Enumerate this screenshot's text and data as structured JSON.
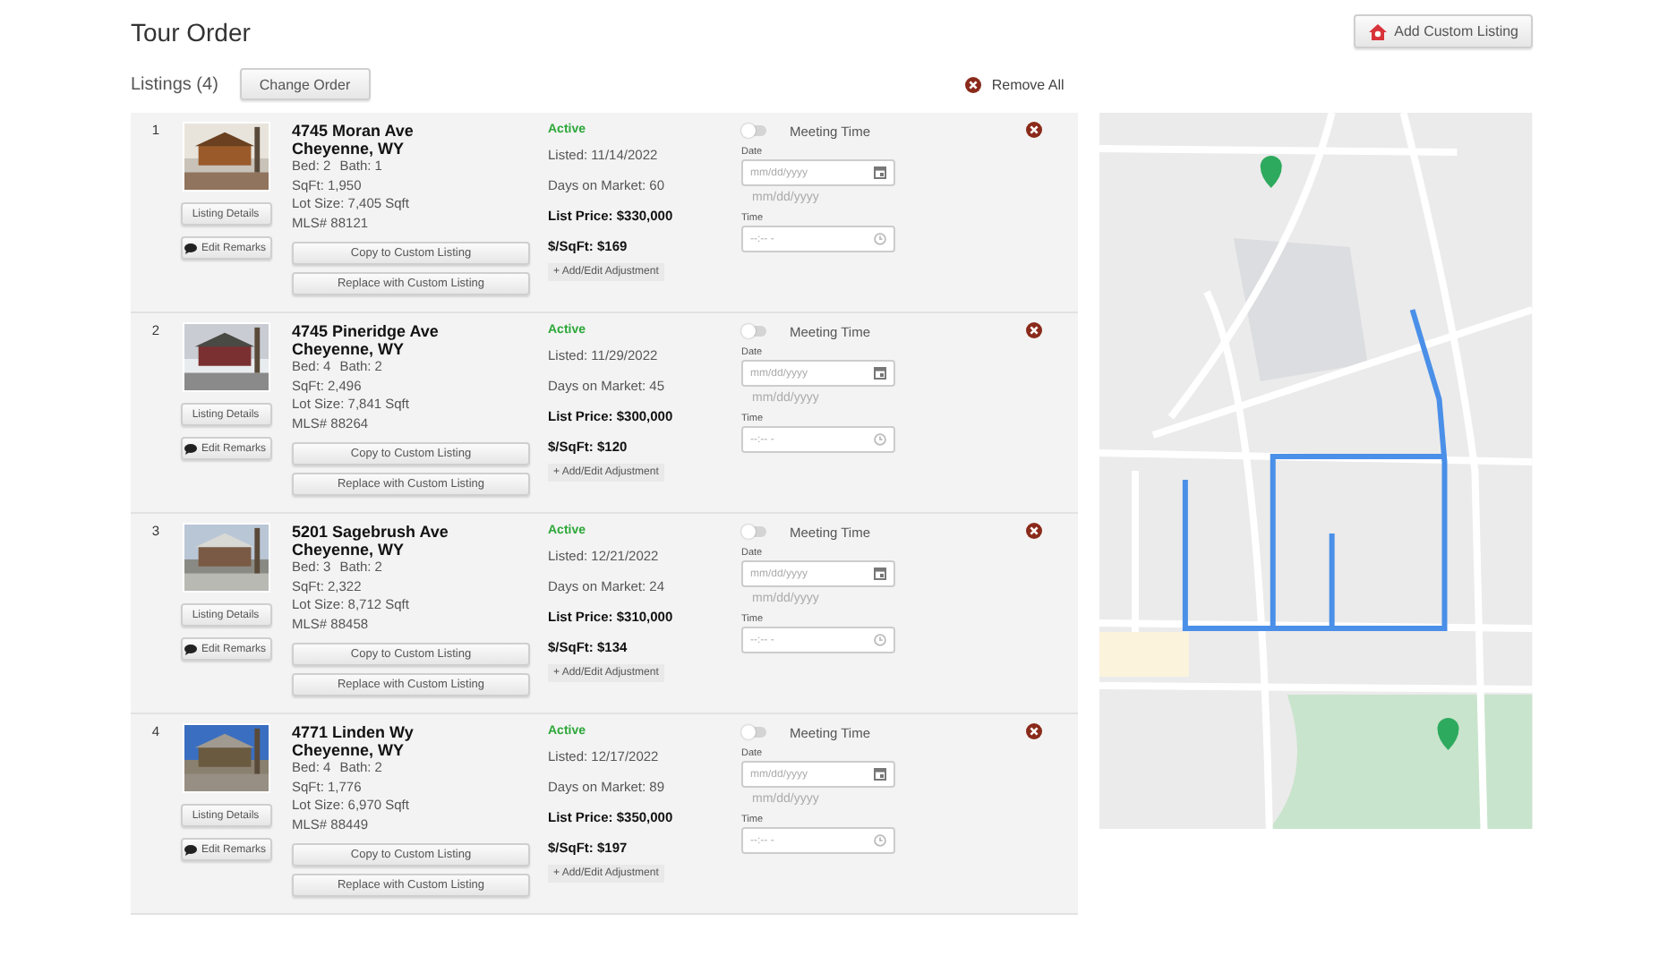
{
  "title": "Tour Order",
  "add_custom_listing": "Add Custom Listing",
  "listings_label": "Listings (4)",
  "change_order": "Change Order",
  "remove_all": "Remove All",
  "listings": [
    {
      "number": "1",
      "listing_details": "Listing Details",
      "edit_remarks": "Edit Remarks",
      "street": "4745 Moran Ave",
      "city": "Cheyenne, WY",
      "bed": "Bed: 2",
      "bath": "Bath: 1",
      "sqft": "SqFt: 1,950",
      "lot": "Lot Size: 7,405 Sqft",
      "mls": "MLS# 88121",
      "copy": "Copy to Custom Listing",
      "replace": "Replace with Custom Listing",
      "status": "Active",
      "listed": "Listed: 11/14/2022",
      "days": "Days on Market: 60",
      "price": "List Price: $330,000",
      "per_sqft": "$/SqFt: $169",
      "adjustment": "+ Add/Edit Adjustment",
      "meeting_on": false,
      "meeting_label": "Meeting Time",
      "date_label": "Date",
      "date_placeholder": "mm/dd/yyyy",
      "date_hint": "mm/dd/yyyy",
      "time_label": "Time",
      "time_placeholder": "--:-- -"
    },
    {
      "number": "2",
      "listing_details": "Listing Details",
      "edit_remarks": "Edit Remarks",
      "street": "4745 Pineridge Ave",
      "city": "Cheyenne, WY",
      "bed": "Bed: 4",
      "bath": "Bath: 2",
      "sqft": "SqFt: 2,496",
      "lot": "Lot Size: 7,841 Sqft",
      "mls": "MLS# 88264",
      "copy": "Copy to Custom Listing",
      "replace": "Replace with Custom Listing",
      "status": "Active",
      "listed": "Listed: 11/29/2022",
      "days": "Days on Market: 45",
      "price": "List Price: $300,000",
      "per_sqft": "$/SqFt: $120",
      "adjustment": "+ Add/Edit Adjustment",
      "meeting_on": false,
      "meeting_label": "Meeting Time",
      "date_label": "Date",
      "date_placeholder": "mm/dd/yyyy",
      "date_hint": "mm/dd/yyyy",
      "time_label": "Time",
      "time_placeholder": "--:-- -"
    },
    {
      "number": "3",
      "listing_details": "Listing Details",
      "edit_remarks": "Edit Remarks",
      "street": "5201 Sagebrush Ave",
      "city": "Cheyenne, WY",
      "bed": "Bed: 3",
      "bath": "Bath: 2",
      "sqft": "SqFt: 2,322",
      "lot": "Lot Size: 8,712 Sqft",
      "mls": "MLS# 88458",
      "copy": "Copy to Custom Listing",
      "replace": "Replace with Custom Listing",
      "status": "Active",
      "listed": "Listed: 12/21/2022",
      "days": "Days on Market: 24",
      "price": "List Price: $310,000",
      "per_sqft": "$/SqFt: $134",
      "adjustment": "+ Add/Edit Adjustment",
      "meeting_on": false,
      "meeting_label": "Meeting Time",
      "date_label": "Date",
      "date_placeholder": "mm/dd/yyyy",
      "date_hint": "mm/dd/yyyy",
      "time_label": "Time",
      "time_placeholder": "--:-- -"
    },
    {
      "number": "4",
      "listing_details": "Listing Details",
      "edit_remarks": "Edit Remarks",
      "street": "4771 Linden Wy",
      "city": "Cheyenne, WY",
      "bed": "Bed: 4",
      "bath": "Bath: 2",
      "sqft": "SqFt: 1,776",
      "lot": "Lot Size: 6,970 Sqft",
      "mls": "MLS# 88449",
      "copy": "Copy to Custom Listing",
      "replace": "Replace with Custom Listing",
      "status": "Active",
      "listed": "Listed: 12/17/2022",
      "days": "Days on Market: 89",
      "price": "List Price: $350,000",
      "per_sqft": "$/SqFt: $197",
      "adjustment": "+ Add/Edit Adjustment",
      "meeting_on": false,
      "meeting_label": "Meeting Time",
      "date_label": "Date",
      "date_placeholder": "mm/dd/yyyy",
      "date_hint": "mm/dd/yyyy",
      "time_label": "Time",
      "time_placeholder": "--:-- -"
    }
  ]
}
